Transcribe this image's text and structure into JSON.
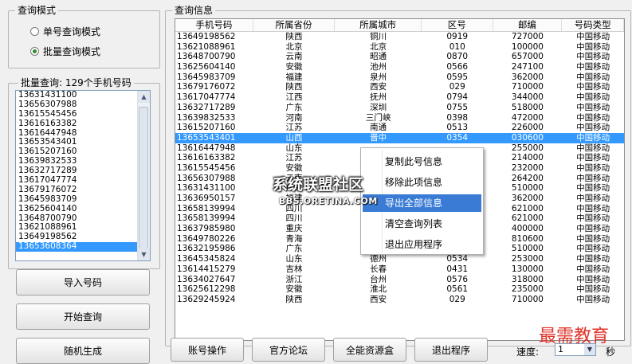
{
  "mode_group": {
    "title": "查询模式",
    "single_label": "单号查询模式",
    "batch_label": "批量查询模式"
  },
  "batch_group": {
    "title": "批量查询: 129个手机号码",
    "numbers": [
      "13631431100",
      "13656307988",
      "13615545456",
      "13616163382",
      "13616447948",
      "13653543401",
      "13615207160",
      "13639832533",
      "13632717289",
      "13617047774",
      "13679176072",
      "13645983709",
      "13625604140",
      "13648700790",
      "13621088961",
      "13649198562",
      "13653608364"
    ],
    "selected_index": 16
  },
  "left_buttons": {
    "import": "导入号码",
    "start": "开始查询",
    "random": "随机生成"
  },
  "info_group": {
    "title": "查询信息",
    "columns": [
      "手机号码",
      "所属省份",
      "所属城市",
      "区号",
      "邮编",
      "号码类型"
    ],
    "rows": [
      [
        "13649198562",
        "陕西",
        "铜川",
        "0919",
        "727000",
        "中国移动"
      ],
      [
        "13621088961",
        "北京",
        "北京",
        "010",
        "100000",
        "中国移动"
      ],
      [
        "13648700790",
        "云南",
        "昭通",
        "0870",
        "657000",
        "中国移动"
      ],
      [
        "13625604140",
        "安徽",
        "池州",
        "0566",
        "247100",
        "中国移动"
      ],
      [
        "13645983709",
        "福建",
        "泉州",
        "0595",
        "362000",
        "中国移动"
      ],
      [
        "13679176072",
        "陕西",
        "西安",
        "029",
        "710000",
        "中国移动"
      ],
      [
        "13617047774",
        "江西",
        "抚州",
        "0794",
        "344000",
        "中国移动"
      ],
      [
        "13632717289",
        "广东",
        "深圳",
        "0755",
        "518000",
        "中国移动"
      ],
      [
        "13639832533",
        "河南",
        "三门峡",
        "0398",
        "472000",
        "中国移动"
      ],
      [
        "13615207160",
        "江苏",
        "南通",
        "0513",
        "226000",
        "中国移动"
      ],
      [
        "13653543401",
        "山西",
        "晋中",
        "0354",
        "030600",
        "中国移动"
      ],
      [
        "13616447948",
        "山东",
        "",
        "",
        "255000",
        "中国移动"
      ],
      [
        "13616163382",
        "江苏",
        "",
        "",
        "214000",
        "中国移动"
      ],
      [
        "13615545456",
        "安徽",
        "",
        "",
        "232000",
        "中国移动"
      ],
      [
        "13656307988",
        "云南",
        "",
        "",
        "264200",
        "中国移动"
      ],
      [
        "13631431100",
        "广东",
        "",
        "",
        "510000",
        "中国移动"
      ],
      [
        "13636950157",
        "福建",
        "",
        "",
        "362000",
        "中国移动"
      ],
      [
        "13658139994",
        "四川",
        "",
        "",
        "621000",
        "中国移动"
      ],
      [
        "13658139994",
        "四川",
        "",
        "",
        "621000",
        "中国移动"
      ],
      [
        "13637985980",
        "重庆",
        "",
        "",
        "400000",
        "中国移动"
      ],
      [
        "13649780226",
        "青海",
        "",
        "",
        "810600",
        "中国移动"
      ],
      [
        "13632195986",
        "广东",
        "广州",
        "020",
        "510000",
        "中国移动"
      ],
      [
        "13645345824",
        "山东",
        "德州",
        "0534",
        "253000",
        "中国移动"
      ],
      [
        "13614415279",
        "吉林",
        "长春",
        "0431",
        "130000",
        "中国移动"
      ],
      [
        "13634027647",
        "浙江",
        "台州",
        "0576",
        "318000",
        "中国移动"
      ],
      [
        "13625612298",
        "安徽",
        "淮北",
        "0561",
        "235000",
        "中国移动"
      ],
      [
        "13629245924",
        "陕西",
        "西安",
        "029",
        "710000",
        "中国移动"
      ]
    ],
    "selected_row": 10
  },
  "context_menu": {
    "items": [
      "复制此号信息",
      "移除此项信息",
      "导出全部信息",
      "清空查询列表",
      "退出应用程序"
    ],
    "highlighted": 2
  },
  "bottom_buttons": {
    "account": "账号操作",
    "forum": "官方论坛",
    "resources": "全能资源盒",
    "exit": "退出程序"
  },
  "speed": {
    "label": "速度:",
    "value": "1",
    "unit": "秒"
  },
  "watermarks": {
    "wm1": "系统联盟社区",
    "wm2": "BBS.ORETINA.COM",
    "wm3": "最需教育"
  },
  "colors": {
    "selection": "#3399ff",
    "menu_highlight": "#3a7bd5",
    "watermark_red": "#e0342b"
  }
}
